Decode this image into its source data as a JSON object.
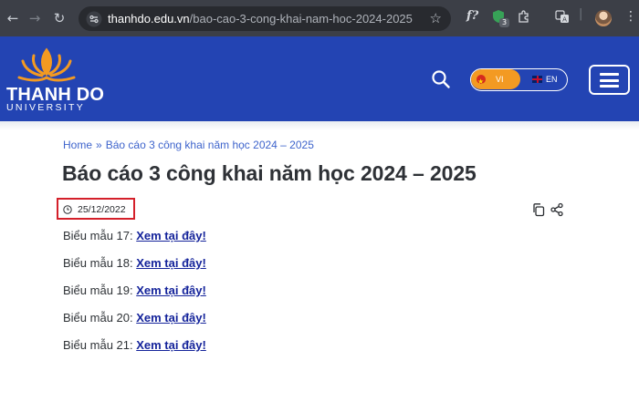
{
  "browser": {
    "url_host": "thanhdo.edu.vn",
    "url_path": "/bao-cao-3-cong-khai-nam-hoc-2024-2025",
    "extension_badge": "3",
    "ext_fx_label": "f?"
  },
  "header": {
    "logo_title": "THANH DO",
    "logo_subtitle": "UNIVERSITY",
    "lang_vi": "VI",
    "lang_en": "EN",
    "colors": {
      "background": "#2344b3",
      "accent": "#f39a22"
    }
  },
  "breadcrumb": {
    "home": "Home",
    "separator": "»",
    "current": "Báo cáo 3 công khai năm học 2024 – 2025"
  },
  "article": {
    "title": "Báo cáo 3 công khai năm học 2024 – 2025",
    "date": "25/12/2022",
    "forms": [
      {
        "label": "Biểu mẫu 17:",
        "link": "Xem tại đây!"
      },
      {
        "label": "Biểu mẫu 18:",
        "link": "Xem tại đây!"
      },
      {
        "label": "Biểu mẫu 19:",
        "link": "Xem tại đây!"
      },
      {
        "label": "Biểu mẫu 20:",
        "link": "Xem tại đây!"
      },
      {
        "label": "Biểu mẫu 21:",
        "link": "Xem tại đây!"
      }
    ]
  }
}
